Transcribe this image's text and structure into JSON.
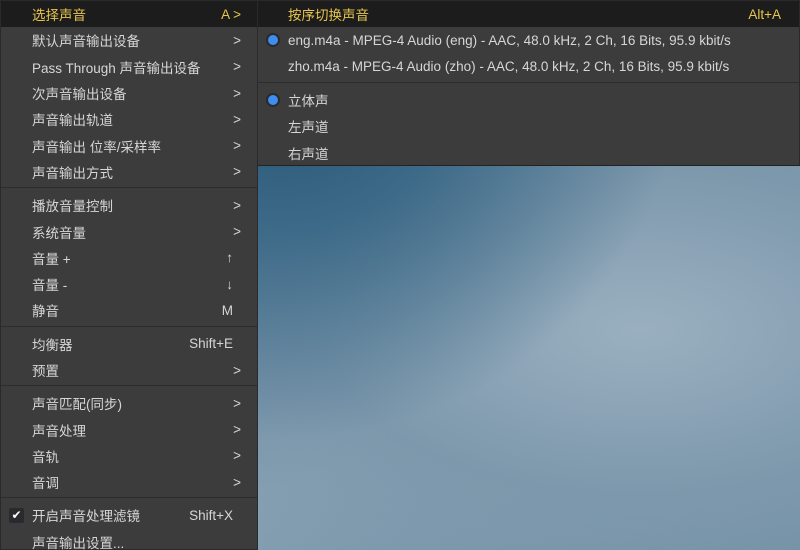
{
  "colors": {
    "accent": "#3d8ef0",
    "highlight_text": "#e6c64c",
    "menu_bg": "#3c3c3c"
  },
  "main_menu": [
    {
      "label": "选择声音",
      "key": "A >",
      "highlighted": true
    },
    {
      "label": "默认声音输出设备",
      "key": ">"
    },
    {
      "label": "Pass Through 声音输出设备",
      "key": ">"
    },
    {
      "label": "次声音输出设备",
      "key": ">"
    },
    {
      "label": "声音输出轨道",
      "key": ">"
    },
    {
      "label": "声音输出 位率/采样率",
      "key": ">"
    },
    {
      "label": "声音输出方式",
      "key": ">"
    },
    {
      "label": "播放音量控制",
      "key": ">"
    },
    {
      "label": "系统音量",
      "key": ">"
    },
    {
      "label": "音量 +",
      "key": "↑"
    },
    {
      "label": "音量 -",
      "key": "↓"
    },
    {
      "label": "静音",
      "key": "M"
    },
    {
      "label": "均衡器",
      "key": "Shift+E"
    },
    {
      "label": "预置",
      "key": ">"
    },
    {
      "label": "声音匹配(同步)",
      "key": ">"
    },
    {
      "label": "声音处理",
      "key": ">"
    },
    {
      "label": "音轨",
      "key": ">"
    },
    {
      "label": "音调",
      "key": ">"
    },
    {
      "label": "开启声音处理滤镜",
      "key": "Shift+X",
      "checked": true
    },
    {
      "label": "声音输出设置...",
      "key": ""
    }
  ],
  "sub_menu": [
    {
      "label": "按序切换声音",
      "key": "Alt+A",
      "highlighted": true
    },
    {
      "label": "eng.m4a - MPEG-4 Audio (eng) - AAC, 48.0 kHz, 2 Ch, 16 Bits, 95.9 kbit/s",
      "selected": true
    },
    {
      "label": "zho.m4a - MPEG-4 Audio (zho) - AAC, 48.0 kHz, 2 Ch, 16 Bits, 95.9 kbit/s"
    },
    {
      "label": "立体声",
      "selected": true
    },
    {
      "label": "左声道"
    },
    {
      "label": "右声道"
    }
  ]
}
